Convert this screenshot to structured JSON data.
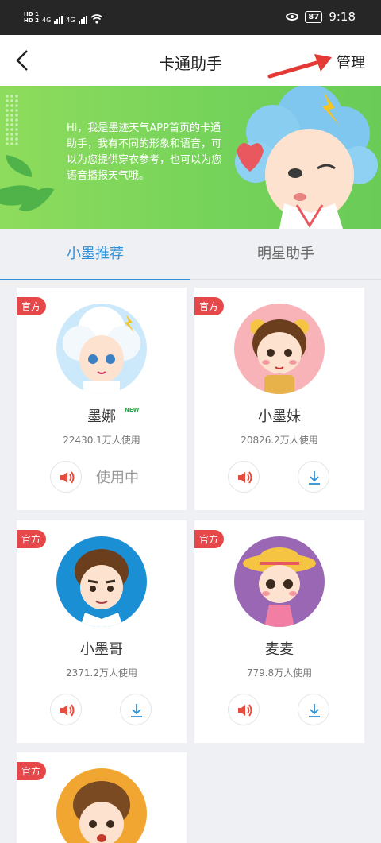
{
  "status_bar": {
    "hd1": "HD 1",
    "hd2": "HD 2",
    "net1": "4G",
    "net2": "4G",
    "battery": "87",
    "time": "9:18"
  },
  "nav": {
    "title": "卡通助手",
    "manage_label": "管理"
  },
  "banner": {
    "text": "Hi，我是墨迹天气APP首页的卡通助手，我有不同的形象和语音，可以为您提供穿衣参考，也可以为您语音播报天气哦。"
  },
  "tabs": [
    {
      "label": "小墨推荐"
    },
    {
      "label": "明星助手"
    }
  ],
  "cards": [
    {
      "badge": "官方",
      "name": "墨娜",
      "new_tag": "NEW",
      "usage": "22430.1万人使用",
      "status": "使用中"
    },
    {
      "badge": "官方",
      "name": "小墨妹",
      "usage": "20826.2万人使用"
    },
    {
      "badge": "官方",
      "name": "小墨哥",
      "usage": "2371.2万人使用"
    },
    {
      "badge": "官方",
      "name": "麦麦",
      "usage": "779.8万人使用"
    },
    {
      "badge": "官方",
      "name": ""
    }
  ],
  "icons": {
    "back": "back-arrow-icon",
    "sound": "speaker-icon",
    "download": "download-icon"
  },
  "colors": {
    "accent": "#2f90d8",
    "badge": "#e6484a",
    "speaker": "#e74c3c",
    "banner": "#76d35a"
  }
}
